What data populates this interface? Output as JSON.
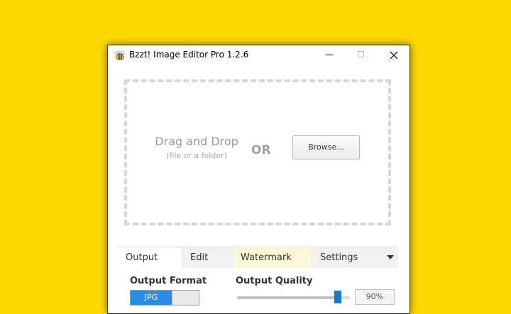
{
  "window": {
    "title": "Bzzt! Image Editor Pro 1.2.6",
    "app_icon": "bee-icon",
    "controls": {
      "minimize": "minimize-icon",
      "maximize": "maximize-icon",
      "close": "close-icon"
    }
  },
  "dropzone": {
    "title": "Drag and Drop",
    "subtitle": "(file or a folder)",
    "or_label": "OR",
    "browse_label": "Browse..."
  },
  "tabs": [
    {
      "label": "Output",
      "active": true
    },
    {
      "label": "Edit"
    },
    {
      "label": "Watermark"
    },
    {
      "label": "Settings"
    }
  ],
  "tabs_more_icon": "chevron-down-icon",
  "output": {
    "format_label": "Output Format",
    "format_selected": "JPG",
    "quality_label": "Output Quality",
    "quality_value": "90%",
    "quality_fraction": 0.9
  },
  "colors": {
    "background": "#FFD700",
    "accent": "#2a8ee6",
    "slider_thumb": "#1976d2",
    "watermark_tab": "#fff5d7"
  }
}
